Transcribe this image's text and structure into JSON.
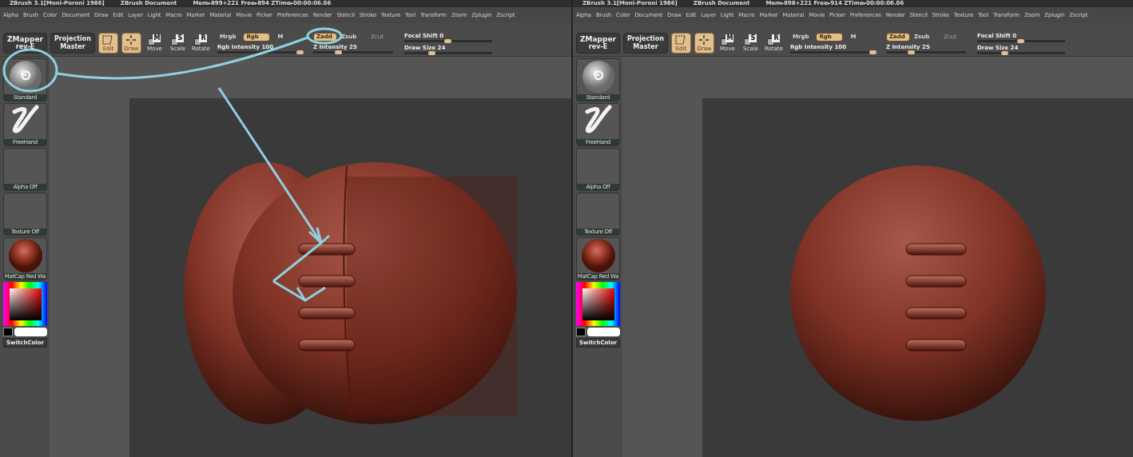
{
  "panels": [
    {
      "title": {
        "app": "ZBrush  3.1[Moni-Poroni 1986]",
        "document": "ZBrush Document",
        "stats": "Mem▸899+221  Free▸894  ZTime▸00:00:06.06"
      },
      "menu": [
        "Alpha",
        "Brush",
        "Color",
        "Document",
        "Draw",
        "Edit",
        "Layer",
        "Light",
        "Macro",
        "Marker",
        "Material",
        "Movie",
        "Picker",
        "Preferences",
        "Render",
        "Stencil",
        "Stroke",
        "Texture",
        "Tool",
        "Transform",
        "Zoom",
        "Zplugin",
        "Zscript"
      ],
      "plugins": [
        {
          "line1": "ZMapper",
          "line2": "rev-E"
        },
        {
          "line1": "Projection",
          "line2": "Master"
        }
      ],
      "modes": [
        {
          "label": "Edit",
          "selected": true,
          "kind": "edit"
        },
        {
          "label": "Draw",
          "selected": true,
          "kind": "draw"
        },
        {
          "label": "Move",
          "selected": false,
          "kind": "move",
          "key": "M"
        },
        {
          "label": "Scale",
          "selected": false,
          "kind": "scale",
          "key": "S"
        },
        {
          "label": "Rotate",
          "selected": false,
          "kind": "rotate",
          "key": "R"
        }
      ],
      "color_modes": [
        {
          "label": "Mrgb",
          "selected": false
        },
        {
          "label": "Rgb",
          "selected": true
        },
        {
          "label": "M",
          "selected": false
        }
      ],
      "depth_modes": [
        {
          "label": "Zadd",
          "selected": true,
          "disabled": false
        },
        {
          "label": "Zsub",
          "selected": false,
          "disabled": false
        },
        {
          "label": "Zcut",
          "selected": false,
          "disabled": true
        }
      ],
      "sliders": [
        {
          "label": "Rgb Intensity 100",
          "level": 1
        },
        {
          "label": "Z Intensity 25",
          "level": 0.3
        },
        {
          "label": "Focal Shift 0",
          "level": 0.5
        },
        {
          "label": "Draw Size 24",
          "level": 0.3
        }
      ],
      "shelf": [
        {
          "label": "Standard",
          "kind": "brush"
        },
        {
          "label": "FreeHand",
          "kind": "stroke"
        },
        {
          "label": "Alpha  Off",
          "kind": "empty"
        },
        {
          "label": "Texture  Off",
          "kind": "empty"
        },
        {
          "label": "MatCap  Red  Wa",
          "kind": "material"
        }
      ],
      "switch_color": "SwitchColor",
      "seam": true,
      "annotated": true
    },
    {
      "title": {
        "app": "ZBrush  3.1[Moni-Poroni 1986]",
        "document": "ZBrush Document",
        "stats": "Mem▸898+221  Free▸914  ZTime▸00:00:06.06"
      },
      "menu": [
        "Alpha",
        "Brush",
        "Color",
        "Document",
        "Draw",
        "Edit",
        "Layer",
        "Light",
        "Macro",
        "Marker",
        "Material",
        "Movie",
        "Picker",
        "Preferences",
        "Render",
        "Stencil",
        "Stroke",
        "Texture",
        "Tool",
        "Transform",
        "Zoom",
        "Zplugin",
        "Zscript"
      ],
      "plugins": [
        {
          "line1": "ZMapper",
          "line2": "rev-E"
        },
        {
          "line1": "Projection",
          "line2": "Master"
        }
      ],
      "modes": [
        {
          "label": "Edit",
          "selected": true,
          "kind": "edit"
        },
        {
          "label": "Draw",
          "selected": true,
          "kind": "draw"
        },
        {
          "label": "Move",
          "selected": false,
          "kind": "move",
          "key": "M"
        },
        {
          "label": "Scale",
          "selected": false,
          "kind": "scale",
          "key": "S"
        },
        {
          "label": "Rotate",
          "selected": false,
          "kind": "rotate",
          "key": "R"
        }
      ],
      "color_modes": [
        {
          "label": "Mrgb",
          "selected": false
        },
        {
          "label": "Rgb",
          "selected": true
        },
        {
          "label": "M",
          "selected": false
        }
      ],
      "depth_modes": [
        {
          "label": "Zadd",
          "selected": true,
          "disabled": false
        },
        {
          "label": "Zsub",
          "selected": false,
          "disabled": false
        },
        {
          "label": "Zcut",
          "selected": false,
          "disabled": true
        }
      ],
      "sliders": [
        {
          "label": "Rgb Intensity 100",
          "level": 1
        },
        {
          "label": "Z Intensity 25",
          "level": 0.3
        },
        {
          "label": "Focal Shift 0",
          "level": 0.5
        },
        {
          "label": "Draw Size 24",
          "level": 0.3
        }
      ],
      "shelf": [
        {
          "label": "Standard",
          "kind": "brush"
        },
        {
          "label": "FreeHand",
          "kind": "stroke"
        },
        {
          "label": "Alpha  Off",
          "kind": "empty"
        },
        {
          "label": "Texture  Off",
          "kind": "empty"
        },
        {
          "label": "MatCap  Red  Wa",
          "kind": "material"
        }
      ],
      "switch_color": "SwitchColor",
      "seam": false,
      "annotated": false
    }
  ]
}
